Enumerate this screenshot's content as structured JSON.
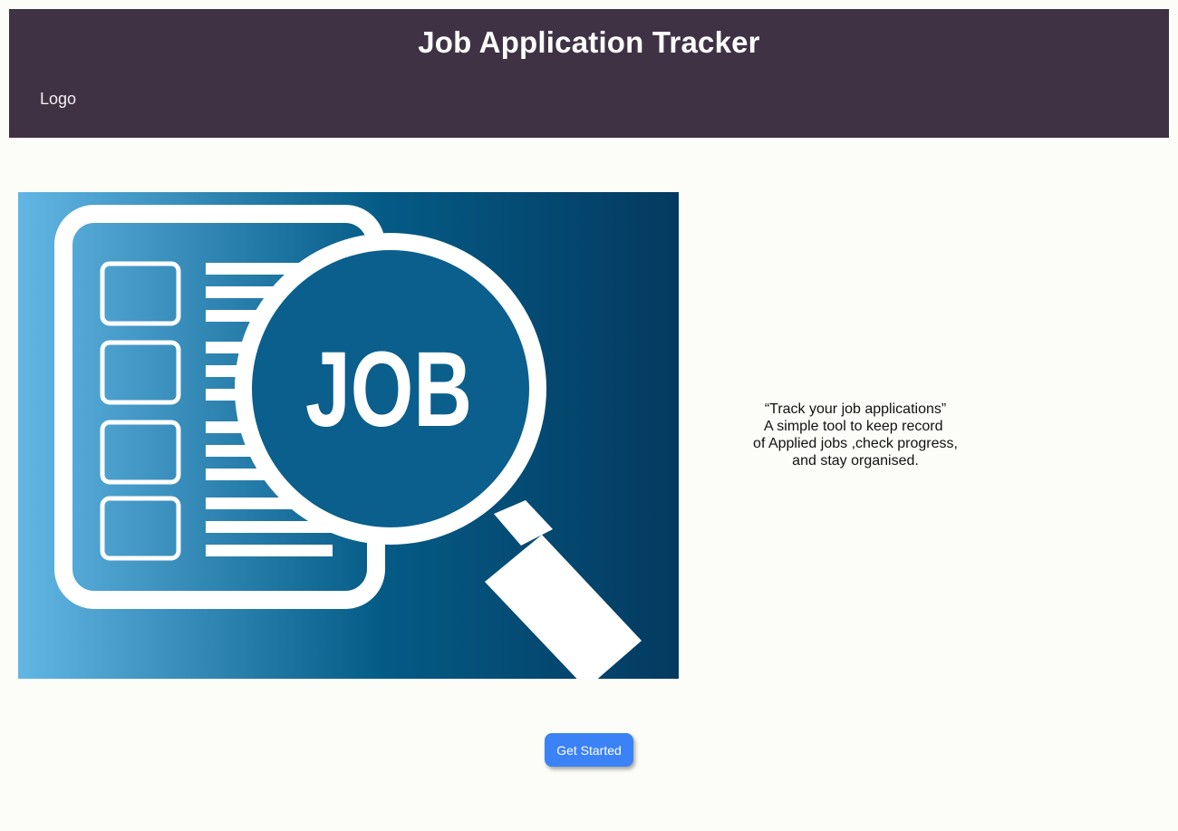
{
  "header": {
    "title": "Job Application Tracker",
    "logo_label": "Logo",
    "background": "#3f3244"
  },
  "hero": {
    "image_text": "JOB",
    "image_description_icon": "magnifier-checklist-icon",
    "gradient": [
      "#5fb4e3",
      "#045a85",
      "#033a60"
    ]
  },
  "tagline": {
    "lines": [
      "“Track your job applications”",
      "A simple tool to keep record ",
      "of Applied jobs ,check progress,",
      "and stay organised."
    ]
  },
  "cta": {
    "label": "Get Started",
    "color": "#3b82f6"
  }
}
